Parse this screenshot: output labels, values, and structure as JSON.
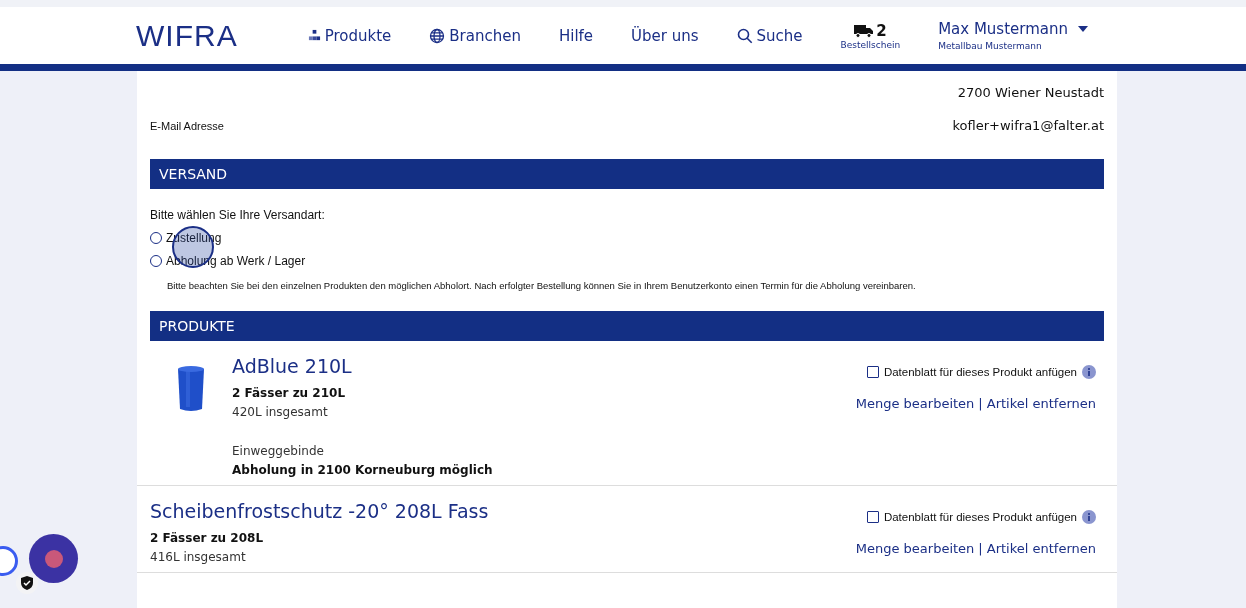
{
  "header": {
    "logo": "WIFRA",
    "nav": [
      {
        "label": "Produkte"
      },
      {
        "label": "Branchen"
      },
      {
        "label": "Hilfe"
      },
      {
        "label": "Über uns"
      },
      {
        "label": "Suche"
      }
    ],
    "cart": {
      "count": "2",
      "label": "Bestellschein"
    },
    "user": {
      "name": "Max Mustermann",
      "company": "Metallbau Mustermann"
    }
  },
  "address": {
    "city_line": "2700 Wiener Neustadt",
    "email_label": "E-Mail Adresse",
    "email": "kofler+wifra1@falter.at"
  },
  "shipping": {
    "title": "VERSAND",
    "prompt": "Bitte wählen Sie Ihre Versandart:",
    "options": [
      {
        "label": "Zustellung",
        "selected": false
      },
      {
        "label": "Abholung ab Werk / Lager",
        "selected": false
      }
    ],
    "note": "Bitte beachten Sie bei den einzelnen Produkten den möglichen Abholort. Nach erfolgter Bestellung können Sie in Ihrem Benutzerkonto einen Termin für die Abholung vereinbaren."
  },
  "products": {
    "title": "PRODUKTE",
    "items": [
      {
        "name": "AdBlue 210L",
        "kind": "pictured",
        "quantity": "2 Fässer zu 210L",
        "total": "420L insgesamt",
        "packaging": "Einweggebinde",
        "pickup": "Abholung in 2100 Korneuburg möglich",
        "datasheet_label": "Datenblatt für dieses Produkt anfügen",
        "datasheet_checked": false,
        "edit_link": "Menge bearbeiten",
        "separator": "|",
        "remove_link": "Artikel entfernen"
      },
      {
        "name": "Scheibenfrostschutz -20° 208L Fass",
        "kind": "plain",
        "quantity": "2 Fässer zu 208L",
        "total": "416L insgesamt",
        "datasheet_label": "Datenblatt für dieses Produkt anfügen",
        "datasheet_checked": false,
        "edit_link": "Menge bearbeiten",
        "separator": "|",
        "remove_link": "Artikel entfernen"
      }
    ]
  }
}
